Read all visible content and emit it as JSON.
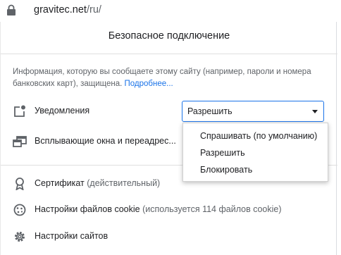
{
  "address_bar": {
    "host": "gravitec.net",
    "path": "/ru/"
  },
  "popup": {
    "title": "Безопасное подключение",
    "info_text": "Информация, которую вы сообщаете этому сайту (например, пароли и номера банковских карт), защищена. ",
    "info_link": "Подробнее...",
    "permissions": {
      "notifications": {
        "label": "Уведомления",
        "selected": "Разрешить",
        "options": [
          "Спрашивать (по умолчанию)",
          "Разрешить",
          "Блокировать"
        ]
      },
      "popups": {
        "label": "Всплывающие окна и переадрес..."
      }
    },
    "certificate": {
      "label": "Сертификат",
      "status": "(действительный)"
    },
    "cookies": {
      "label": "Настройки файлов cookie",
      "detail": "(используется 114 файлов cookie)"
    },
    "site_settings": {
      "label": "Настройки сайтов"
    }
  },
  "colors": {
    "link": "#1a73e8",
    "text": "#202124",
    "muted": "#5f6368",
    "icon": "#5f6368"
  }
}
